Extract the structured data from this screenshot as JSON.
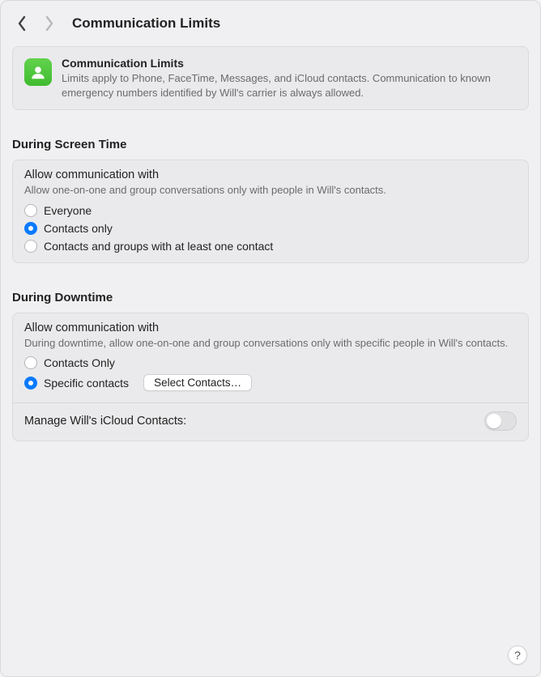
{
  "header": {
    "title": "Communication Limits"
  },
  "info_card": {
    "title": "Communication Limits",
    "description": "Limits apply to Phone, FaceTime, Messages, and iCloud contacts. Communication to known emergency numbers identified by Will's carrier is always allowed."
  },
  "screentime": {
    "section_title": "During Screen Time",
    "group_title": "Allow communication with",
    "group_desc": "Allow one-on-one and group conversations only with people in Will's contacts.",
    "options": [
      {
        "label": "Everyone",
        "selected": false
      },
      {
        "label": "Contacts only",
        "selected": true
      },
      {
        "label": "Contacts and groups with at least one contact",
        "selected": false
      }
    ]
  },
  "downtime": {
    "section_title": "During Downtime",
    "group_title": "Allow communication with",
    "group_desc": "During downtime, allow one-on-one and group conversations only with specific people in Will's contacts.",
    "options": [
      {
        "label": "Contacts Only",
        "selected": false
      },
      {
        "label": "Specific contacts",
        "selected": true
      }
    ],
    "select_contacts_label": "Select Contacts…",
    "manage_label": "Manage Will's iCloud Contacts:",
    "manage_enabled": false
  },
  "help_label": "?"
}
